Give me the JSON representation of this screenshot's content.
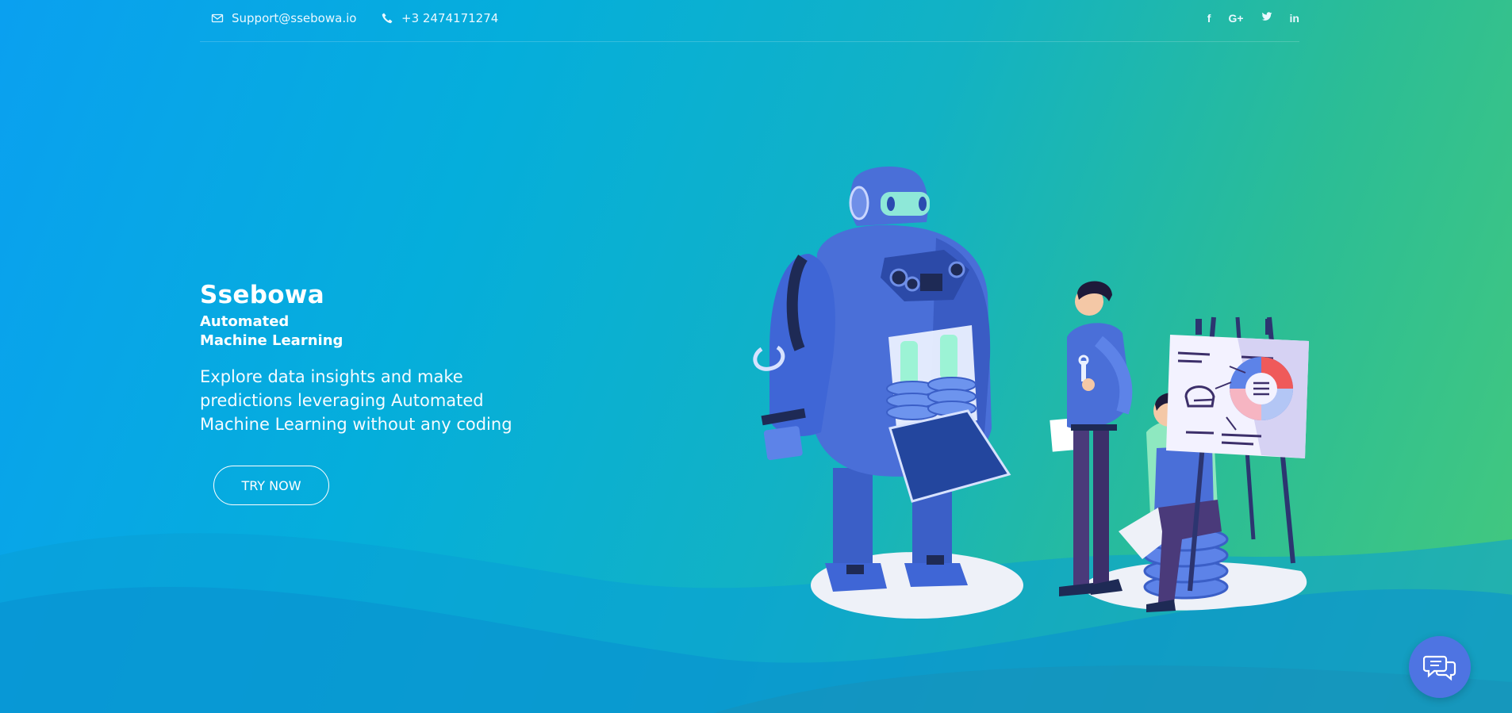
{
  "topbar": {
    "email": "Support@ssebowa.io",
    "phone": "+3 2474171274",
    "social": [
      {
        "label": "f",
        "icon": "facebook-icon"
      },
      {
        "label": "G+",
        "icon": "google-plus-icon"
      },
      {
        "label": "🐦",
        "icon": "twitter-icon"
      },
      {
        "label": "in",
        "icon": "linkedin-icon"
      }
    ]
  },
  "hero": {
    "brand": "Ssebowa",
    "tagline_line1": "Automated",
    "tagline_line2": "Machine Learning",
    "description_line1": "Explore data insights and make",
    "description_line2": "predictions leveraging Automated",
    "description_line3": "Machine Learning without any coding",
    "cta_label": "TRY NOW"
  },
  "colors": {
    "gradient_start": "#0aa0f0",
    "gradient_end": "#45c97c",
    "robot_blue": "#4a6fd8",
    "chat_button": "#4e74e2"
  },
  "icons": {
    "chat": "chat-bubbles-icon",
    "email": "envelope-icon",
    "phone": "phone-icon"
  }
}
